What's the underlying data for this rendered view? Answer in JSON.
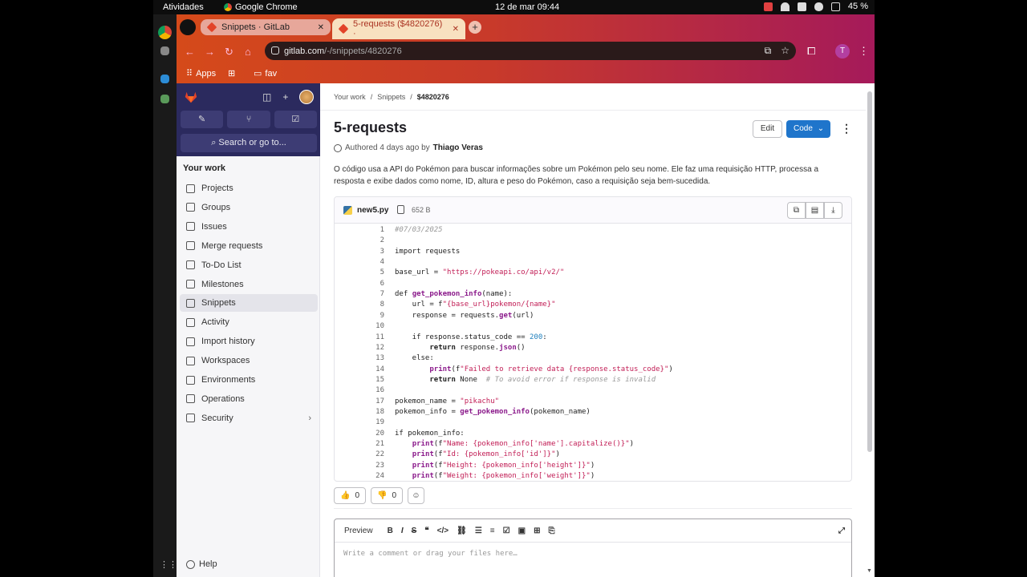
{
  "os": {
    "activities": "Atividades",
    "app": "Google Chrome",
    "clock": "12 de mar  09:44",
    "battery": "45 %"
  },
  "browser": {
    "tabs": [
      {
        "label": "Snippets · GitLab"
      },
      {
        "label": "5-requests ($4820276) ·"
      }
    ],
    "url_host": "gitlab.com",
    "url_path": "/-/snippets/4820276",
    "profile_letter": "T",
    "bookmarks": {
      "apps": "Apps",
      "fav": "fav"
    }
  },
  "gitlab": {
    "search_placeholder": "Search or go to...",
    "sidebar_heading": "Your work",
    "sidebar_items": [
      {
        "label": "Projects",
        "icon": "project-icon"
      },
      {
        "label": "Groups",
        "icon": "group-icon"
      },
      {
        "label": "Issues",
        "icon": "issues-icon"
      },
      {
        "label": "Merge requests",
        "icon": "merge-request-icon"
      },
      {
        "label": "To-Do List",
        "icon": "todo-icon"
      },
      {
        "label": "Milestones",
        "icon": "milestone-icon"
      },
      {
        "label": "Snippets",
        "icon": "snippet-icon",
        "active": true
      },
      {
        "label": "Activity",
        "icon": "activity-icon"
      },
      {
        "label": "Import history",
        "icon": "import-icon"
      },
      {
        "label": "Workspaces",
        "icon": "workspace-icon"
      },
      {
        "label": "Environments",
        "icon": "environment-icon"
      },
      {
        "label": "Operations",
        "icon": "operations-icon"
      },
      {
        "label": "Security",
        "icon": "shield-icon"
      }
    ],
    "help": "Help"
  },
  "snippet": {
    "breadcrumb": [
      "Your work",
      "Snippets",
      "$4820276"
    ],
    "title": "5-requests",
    "edit_label": "Edit",
    "code_label": "Code",
    "authored_prefix": "Authored 4 days ago by",
    "author": "Thiago Veras",
    "description": "O código usa a API do Pokémon para buscar informações sobre um Pokémon pelo seu nome. Ele faz uma requisição HTTP, processa a resposta e exibe dados como nome, ID, altura e peso do Pokémon, caso a requisição seja bem-sucedida.",
    "file_name": "new5.py",
    "file_size": "652 B",
    "code_lines": [
      "#07/03/2025",
      "",
      "import requests",
      "",
      "base_url = \"https://pokeapi.co/api/v2/\"",
      "",
      "def get_pokemon_info(name):",
      "    url = f\"{base_url}pokemon/{name}\"",
      "    response = requests.get(url)",
      "",
      "    if response.status_code == 200:",
      "        return response.json()",
      "    else:",
      "        print(f\"Failed to retrieve data {response.status_code}\")",
      "        return None  # To avoid error if response is invalid",
      "",
      "pokemon_name = \"pikachu\"",
      "pokemon_info = get_pokemon_info(pokemon_name)",
      "",
      "if pokemon_info:",
      "    print(f\"Name: {pokemon_info['name'].capitalize()}\")",
      "    print(f\"Id: {pokemon_info['id']}\")",
      "    print(f\"Height: {pokemon_info['height']}\")",
      "    print(f\"Weight: {pokemon_info['weight']}\")"
    ],
    "thumbs_up": "0",
    "thumbs_down": "0",
    "comment_preview": "Preview",
    "comment_placeholder": "Write a comment or drag your files here…"
  },
  "colors": {
    "gitlab_nav": "#2b2a5e",
    "primary_button": "#1f75cb",
    "browser_gradient": "#c83a2a"
  }
}
